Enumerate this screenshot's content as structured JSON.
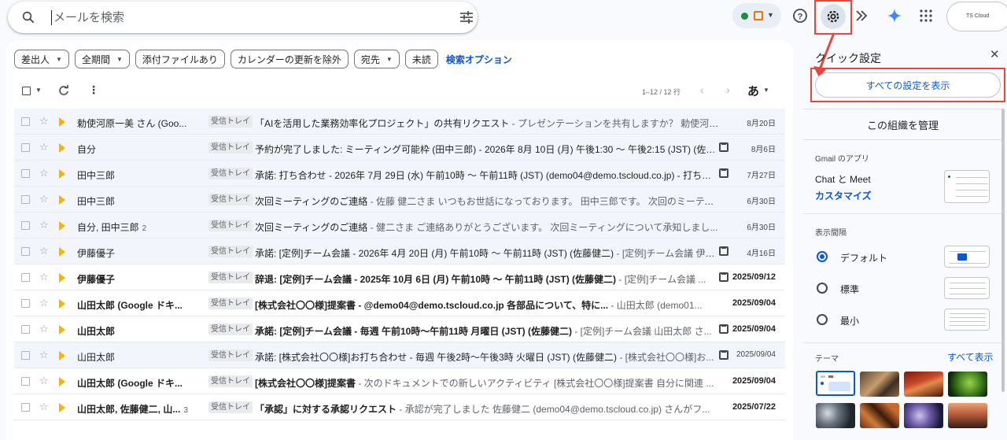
{
  "search": {
    "placeholder": "メールを検索"
  },
  "account": {
    "label": "TS Cloud"
  },
  "filters": {
    "chips": [
      "差出人",
      "全期間",
      "添付ファイルあり",
      "カレンダーの更新を除外",
      "宛先",
      "未読"
    ],
    "advanced": "検索オプション"
  },
  "toolbar": {
    "pagination": "1–12 / 12 行",
    "input_tool": "あ"
  },
  "emails": [
    {
      "sender": "勅使河原一美 さん (Goo...",
      "count": "",
      "label": "受信トレイ",
      "subject": "「AIを活用した業務効率化プロジェクト」の共有リクエスト",
      "snippet": " - プレゼンテーションを共有しますか？ 勅使河原...",
      "date": "8月20日",
      "calendar": false,
      "unread": false
    },
    {
      "sender": "自分",
      "count": "",
      "label": "受信トレイ",
      "subject": "予約が完了しました: ミーティング可能枠 (田中三郎) - 2026年 8月 10日 (月) 午後1:30 〜 午後2:15 (JST) (佐藤...",
      "snippet": "",
      "date": "8月6日",
      "calendar": true,
      "unread": false
    },
    {
      "sender": "田中三郎",
      "count": "",
      "label": "受信トレイ",
      "subject": "承諾: 打ち合わせ - 2026年 7月 29日 (水) 午前10時 〜 午前11時 (JST) (demo04@demo.tscloud.co.jp) - 打ち合...",
      "snippet": "",
      "date": "7月27日",
      "calendar": true,
      "unread": false
    },
    {
      "sender": "田中三郎",
      "count": "",
      "label": "受信トレイ",
      "subject": "次回ミーティングのご連絡",
      "snippet": " - 佐藤 健二さま いつもお世話になっております。 田中三郎です。 次回のミーティ...",
      "date": "6月30日",
      "calendar": false,
      "unread": false
    },
    {
      "sender": "自分, 田中三郎",
      "count": "2",
      "label": "受信トレイ",
      "subject": "次回ミーティングのご連絡",
      "snippet": " - 健二さま ご連絡ありがとうございます。 次回ミーティングについて承知しまし...",
      "date": "6月30日",
      "calendar": false,
      "unread": false
    },
    {
      "sender": "伊藤優子",
      "count": "",
      "label": "受信トレイ",
      "subject": "承諾: [定例]チーム会議 - 2026年 4月 20日 (月) 午前10時 〜 午前11時 (JST) (佐藤健二)",
      "snippet": " - [定例]チーム会議 伊藤...",
      "date": "4月16日",
      "calendar": true,
      "unread": false
    },
    {
      "sender": "伊藤優子",
      "count": "",
      "label": "受信トレイ",
      "subject": "辞退: [定例]チーム会議 - 2025年 10月 6日 (月) 午前10時 〜 午前11時 (JST) (佐藤健二)",
      "snippet": " - [定例]チーム会議 ...",
      "date": "2025/09/12",
      "calendar": true,
      "unread": true
    },
    {
      "sender": "山田太郎 (Google ドキ...",
      "count": "",
      "label": "受信トレイ",
      "subject": "[株式会社〇〇様]提案書 - @demo04@demo.tscloud.co.jp 各部品について、特に...",
      "snippet": " - 山田太郎 (demo01...",
      "date": "2025/09/04",
      "calendar": false,
      "unread": true
    },
    {
      "sender": "山田太郎",
      "count": "",
      "label": "受信トレイ",
      "subject": "承諾: [定例]チーム会議 - 毎週 午前10時〜午前11時 月曜日 (JST) (佐藤健二)",
      "snippet": " - [定例]チーム会議 山田太郎 さ...",
      "date": "2025/09/04",
      "calendar": true,
      "unread": true
    },
    {
      "sender": "山田太郎",
      "count": "",
      "label": "受信トレイ",
      "subject": "承諾: [株式会社〇〇様]お打ち合わせ - 毎週 午後2時〜午後3時 火曜日 (JST) (佐藤健二)",
      "snippet": " - [株式会社〇〇様]お...",
      "date": "2025/09/04",
      "calendar": true,
      "unread": false
    },
    {
      "sender": "山田太郎 (Google ドキ...",
      "count": "",
      "label": "受信トレイ",
      "subject": "[株式会社〇〇様]提案書",
      "snippet": " - 次のドキュメントでの新しいアクティビティ [株式会社〇〇様]提案書 自分に関連 ...",
      "date": "2025/09/04",
      "calendar": false,
      "unread": true
    },
    {
      "sender": "山田太郎, 佐藤健二, 山...",
      "count": "3",
      "label": "受信トレイ",
      "subject": "「承認」に対する承認リクエスト",
      "snippet": " - 承認が完了しました 佐藤健二 (demo04@demo.tscloud.co.jp) さんがフ...",
      "date": "2025/07/22",
      "calendar": false,
      "unread": true
    }
  ],
  "quick_settings": {
    "title": "クイック設定",
    "all_settings": "すべての設定を表示",
    "manage_org": "この組織を管理",
    "gmail_apps": "Gmail のアプリ",
    "chat_meet": "Chat と Meet",
    "customize": "カスタマイズ",
    "density_title": "表示間隔",
    "density": [
      "デフォルト",
      "標準",
      "最小"
    ],
    "theme_title": "テーマ",
    "theme_all": "すべて表示"
  },
  "colors": {
    "accent": "#0b57d0",
    "highlight_box": "#e8453c",
    "important": "#f4b400",
    "presence": "#1e8e3e"
  }
}
